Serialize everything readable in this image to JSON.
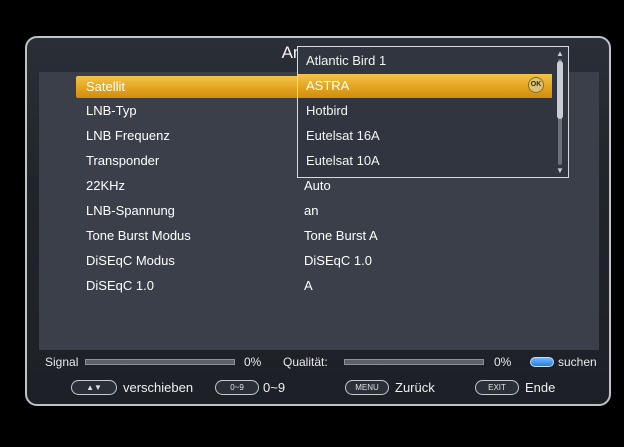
{
  "title": "Antennen",
  "rows": [
    {
      "label": "Satellit",
      "value": ""
    },
    {
      "label": "LNB-Typ",
      "value": ""
    },
    {
      "label": "LNB Frequenz",
      "value": ""
    },
    {
      "label": "Transponder",
      "value": ""
    },
    {
      "label": "22KHz",
      "value": "Auto"
    },
    {
      "label": "LNB-Spannung",
      "value": "an"
    },
    {
      "label": "Tone Burst Modus",
      "value": "Tone Burst A"
    },
    {
      "label": "DiSEqC Modus",
      "value": "DiSEqC 1.0"
    },
    {
      "label": "DiSEqC 1.0",
      "value": "A"
    }
  ],
  "dropdown": {
    "items": [
      "Atlantic Bird 1",
      "ASTRA",
      "Hotbird",
      "Eutelsat 16A",
      "Eutelsat 10A"
    ],
    "selected_index": 1,
    "ok_icon": "ok-icon"
  },
  "status": {
    "signal_label": "Signal",
    "signal_value": "0%",
    "signal_level": 0,
    "quality_label": "Qualität:",
    "quality_value": "0%",
    "quality_level": 0,
    "search_label": "suchen"
  },
  "footer": {
    "move_key": "▲▼",
    "move_label": "verschieben",
    "digits_key": "0~9",
    "digits_label": "0~9",
    "menu_key": "MENU",
    "menu_label": "Zurück",
    "exit_key": "EXIT",
    "exit_label": "Ende"
  },
  "colors": {
    "highlight": "#E3A41F",
    "panel_bg": "#3A3F49",
    "search_button": "#2C7FD8"
  }
}
